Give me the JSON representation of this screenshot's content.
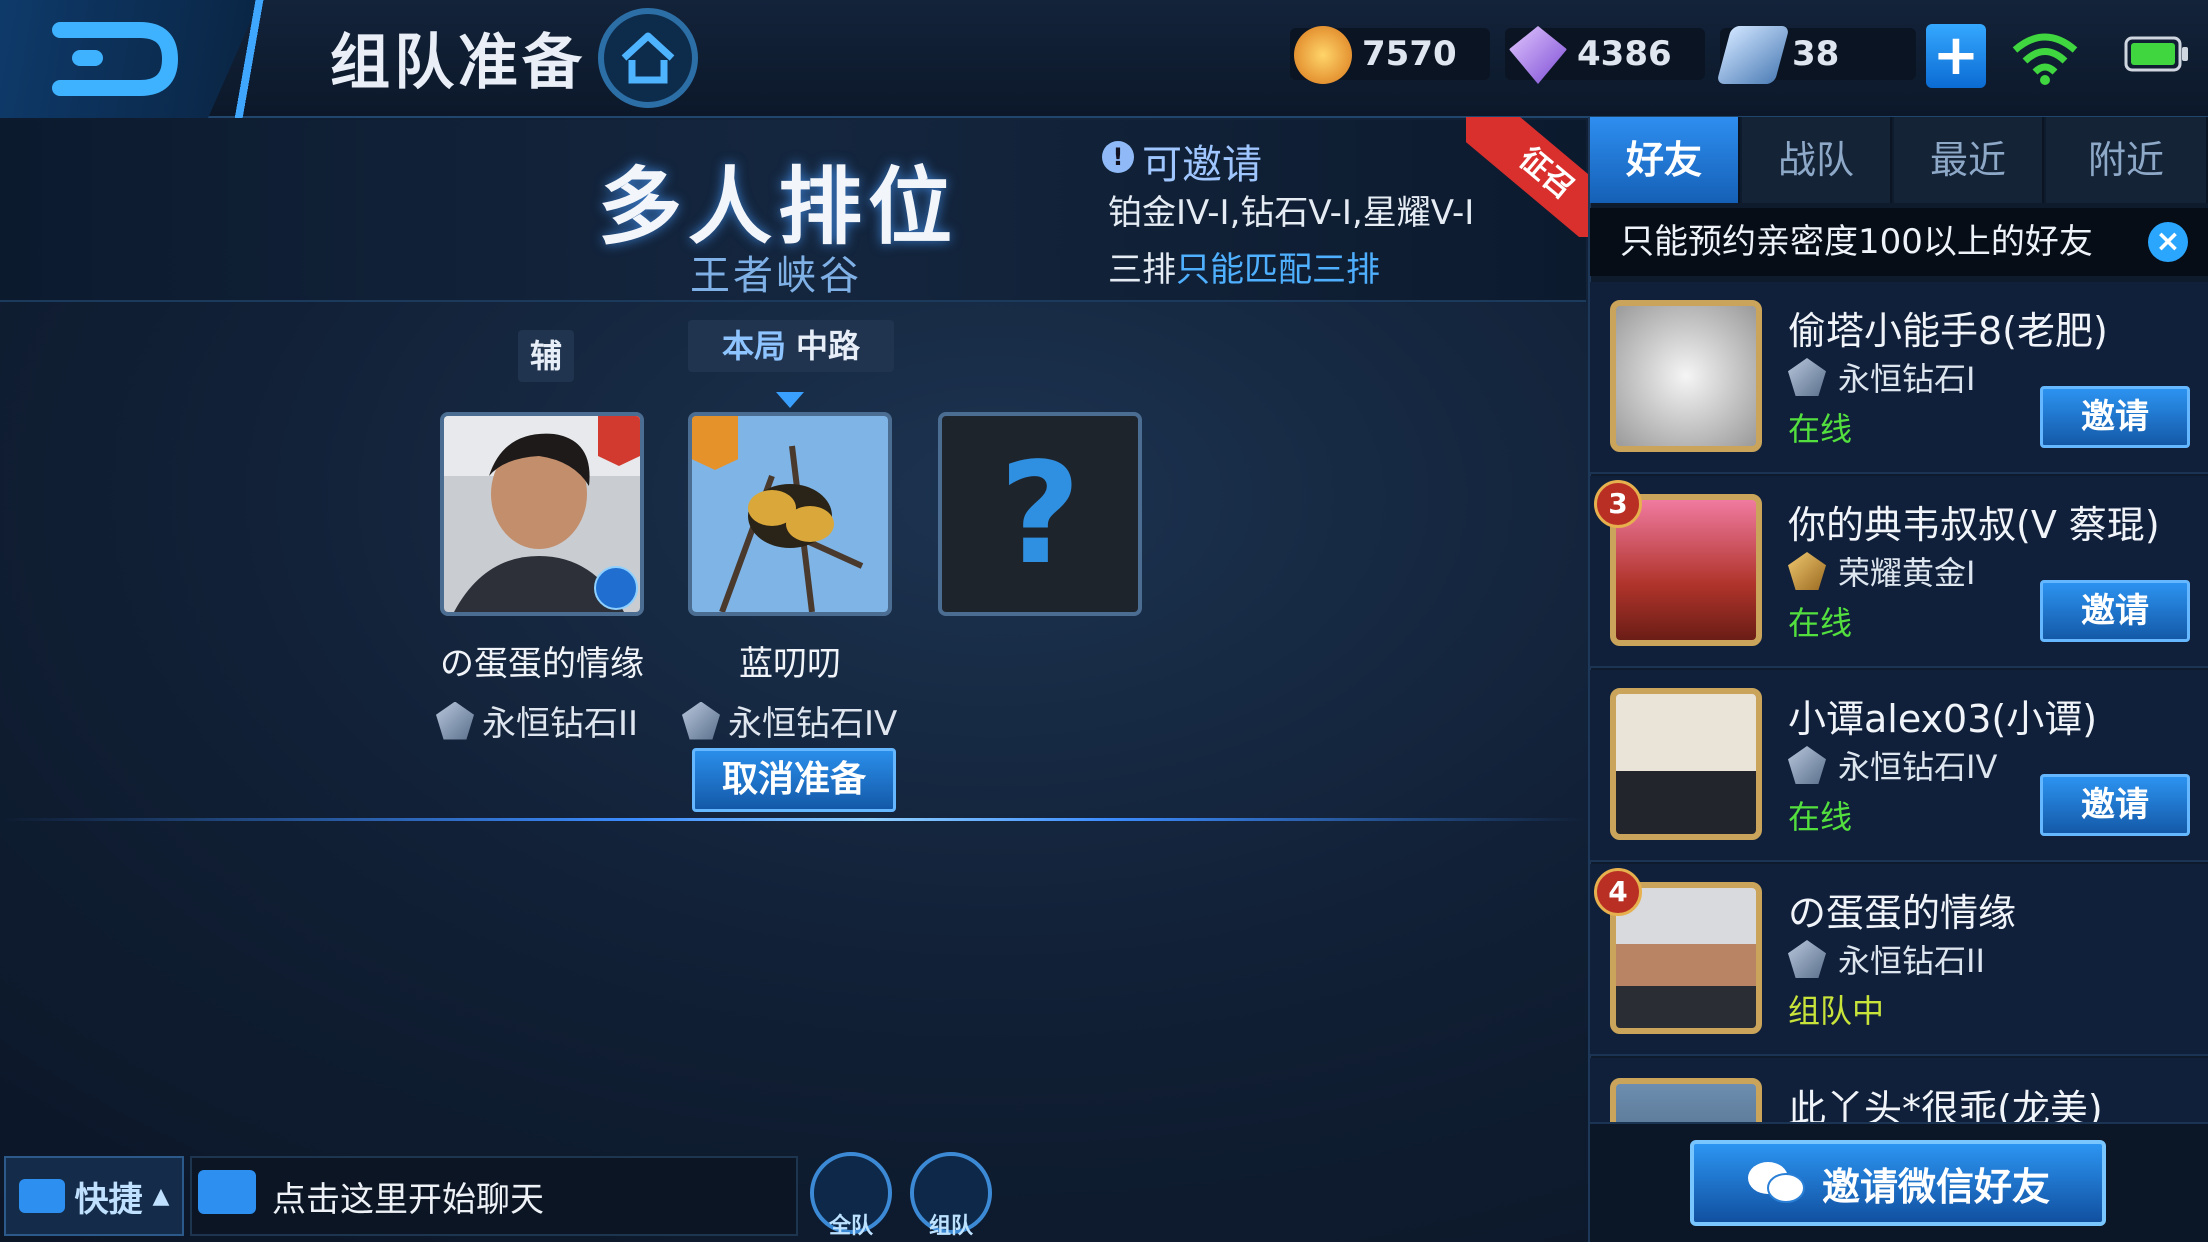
{
  "header": {
    "title": "组队准备",
    "currencies": [
      {
        "name": "gold",
        "value": "7570",
        "color": "#f0a020",
        "icon": "gold-coin-icon"
      },
      {
        "name": "diamond",
        "value": "4386",
        "color": "#b58bf0",
        "icon": "diamond-icon"
      },
      {
        "name": "coupon",
        "value": "38",
        "color": "#7fb2e6",
        "icon": "coupon-icon"
      }
    ],
    "plus": "+"
  },
  "mode": {
    "title": "多人排位",
    "map": "王者峡谷",
    "invite_label": "可邀请",
    "invite_ranks": "铂金IV-I,钻石V-I,星耀V-I",
    "triple_prefix": "三排",
    "triple_rule": "只能匹配三排",
    "recruit_tag": "征召"
  },
  "slots": [
    {
      "role": "辅",
      "name": "の蛋蛋的情缘",
      "rank": "永恒钻石II"
    },
    {
      "role_prefix": "本局",
      "role": "中路",
      "name": "蓝叨叨",
      "rank": "永恒钻石IV",
      "action": "取消准备"
    },
    {
      "empty": "?"
    }
  ],
  "friends_panel": {
    "tabs": [
      "好友",
      "战队",
      "最近",
      "附近"
    ],
    "active_tab": "好友",
    "notice": "只能预约亲密度100以上的好友",
    "friends": [
      {
        "name": "偷塔小能手8(老肥)",
        "rank": "永恒钻石I",
        "status": "在线",
        "action": "邀请"
      },
      {
        "level": "3",
        "name": "你的典韦叔叔(V 蔡琨)",
        "rank": "荣耀黄金I",
        "status": "在线",
        "action": "邀请"
      },
      {
        "name": "小谭alex03(小谭)",
        "rank": "永恒钻石IV",
        "status": "在线",
        "action": "邀请"
      },
      {
        "level": "4",
        "name": "の蛋蛋的情缘",
        "rank": "永恒钻石II",
        "status": "组队中"
      },
      {
        "name": "此丫头*很乖(龙美)"
      }
    ],
    "wechat_invite": "邀请微信好友"
  },
  "chat": {
    "quick": "快捷",
    "placeholder": "点击这里开始聊天",
    "voice_all": "全队",
    "voice_team": "组队"
  }
}
